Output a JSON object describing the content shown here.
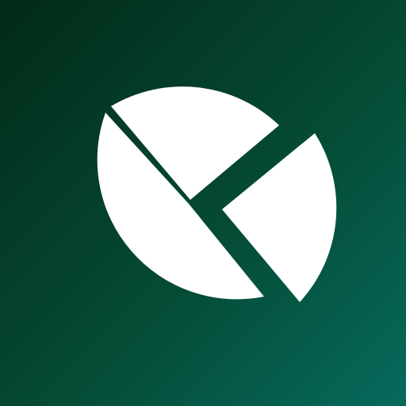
{
  "icon": {
    "name": "pie-chart-logo",
    "colors": {
      "background_top_left": "#022a18",
      "background_mid": "#054a34",
      "background_bottom_right": "#066a5d",
      "foreground": "#ffffff"
    }
  }
}
